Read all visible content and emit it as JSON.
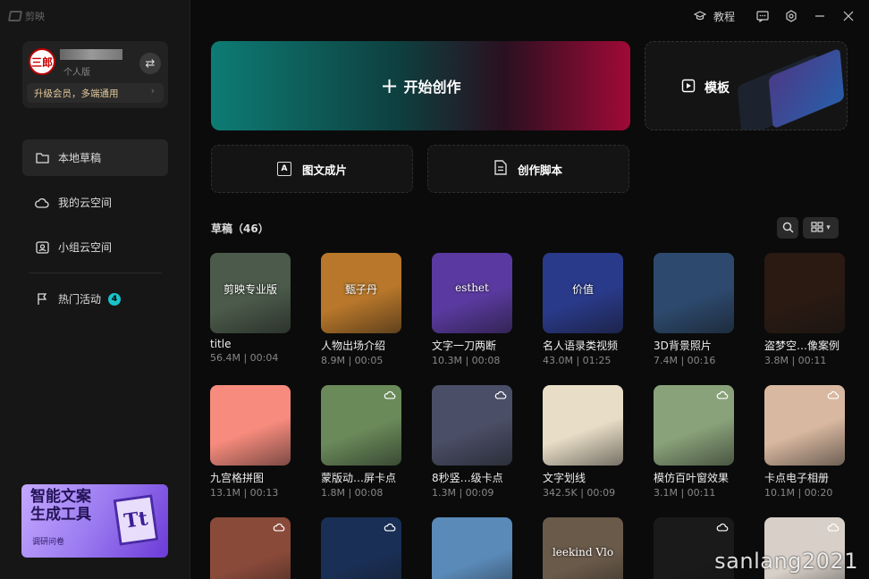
{
  "app": {
    "logo_text": "剪映"
  },
  "user": {
    "avatar_text": "三郎",
    "version": "个人版",
    "upgrade": "升级会员，多端通用"
  },
  "nav": [
    {
      "label": "本地草稿",
      "icon": "folder-icon"
    },
    {
      "label": "我的云空间",
      "icon": "cloud-icon"
    },
    {
      "label": "小组云空间",
      "icon": "group-icon"
    },
    {
      "label": "热门活动",
      "icon": "flag-icon",
      "badge": "4"
    }
  ],
  "promo": {
    "title_line1": "智能文案",
    "title_line2": "生成工具",
    "subtitle": "调研问卷",
    "glyph": "Tt"
  },
  "topbar": {
    "tutorial": "教程"
  },
  "main": {
    "start_label": "开始创作",
    "template_label": "模板",
    "image_to_video": "图文成片",
    "script_label": "创作脚本",
    "drafts_title": "草稿（46）"
  },
  "drafts": [
    {
      "name": "title",
      "meta": "56.4M | 00:04",
      "cloud": false,
      "thumb": "#4b5a4a",
      "caption": "剪映专业版"
    },
    {
      "name": "人物出场介绍",
      "meta": "8.9M | 00:05",
      "cloud": false,
      "thumb": "#b8772a",
      "caption": "甄子丹"
    },
    {
      "name": "文字一刀两断",
      "meta": "10.3M | 00:08",
      "cloud": false,
      "thumb": "#5a3aa0",
      "caption": "esthet"
    },
    {
      "name": "名人语录类视频",
      "meta": "43.0M | 01:25",
      "cloud": false,
      "thumb": "#2a3a8a",
      "caption": "价值"
    },
    {
      "name": "3D背景照片",
      "meta": "7.4M | 00:16",
      "cloud": false,
      "thumb": "#2d4a6e",
      "caption": ""
    },
    {
      "name": "盗梦空…像案例",
      "meta": "3.8M | 00:11",
      "cloud": false,
      "thumb": "#2a1a12",
      "caption": ""
    },
    {
      "name": "九宫格拼图",
      "meta": "13.1M | 00:13",
      "cloud": false,
      "thumb": "#f78b7d",
      "caption": ""
    },
    {
      "name": "蒙版动…屏卡点",
      "meta": "1.8M | 00:08",
      "cloud": true,
      "thumb": "#6a8a5a",
      "caption": ""
    },
    {
      "name": "8秒竖…级卡点",
      "meta": "1.3M | 00:09",
      "cloud": true,
      "thumb": "#4a4e66",
      "caption": ""
    },
    {
      "name": "文字划线",
      "meta": "342.5K | 00:09",
      "cloud": false,
      "thumb": "#e8ddc6",
      "caption": ""
    },
    {
      "name": "模仿百叶窗效果",
      "meta": "3.1M | 00:11",
      "cloud": true,
      "thumb": "#8aa27a",
      "caption": ""
    },
    {
      "name": "卡点电子相册",
      "meta": "10.1M | 00:20",
      "cloud": true,
      "thumb": "#d8b8a0",
      "caption": ""
    },
    {
      "name": "",
      "meta": "",
      "cloud": true,
      "thumb": "#8a4a3a",
      "caption": ""
    },
    {
      "name": "",
      "meta": "",
      "cloud": true,
      "thumb": "#1a2f55",
      "caption": ""
    },
    {
      "name": "",
      "meta": "",
      "cloud": false,
      "thumb": "#5a8ab8",
      "caption": ""
    },
    {
      "name": "",
      "meta": "",
      "cloud": false,
      "thumb": "#6a5a4a",
      "caption": "leekind Vlo"
    },
    {
      "name": "",
      "meta": "",
      "cloud": true,
      "thumb": "#1a1a1a",
      "caption": ""
    },
    {
      "name": "",
      "meta": "",
      "cloud": true,
      "thumb": "#d8d0c8",
      "caption": ""
    }
  ],
  "watermark": "sanlang2021"
}
